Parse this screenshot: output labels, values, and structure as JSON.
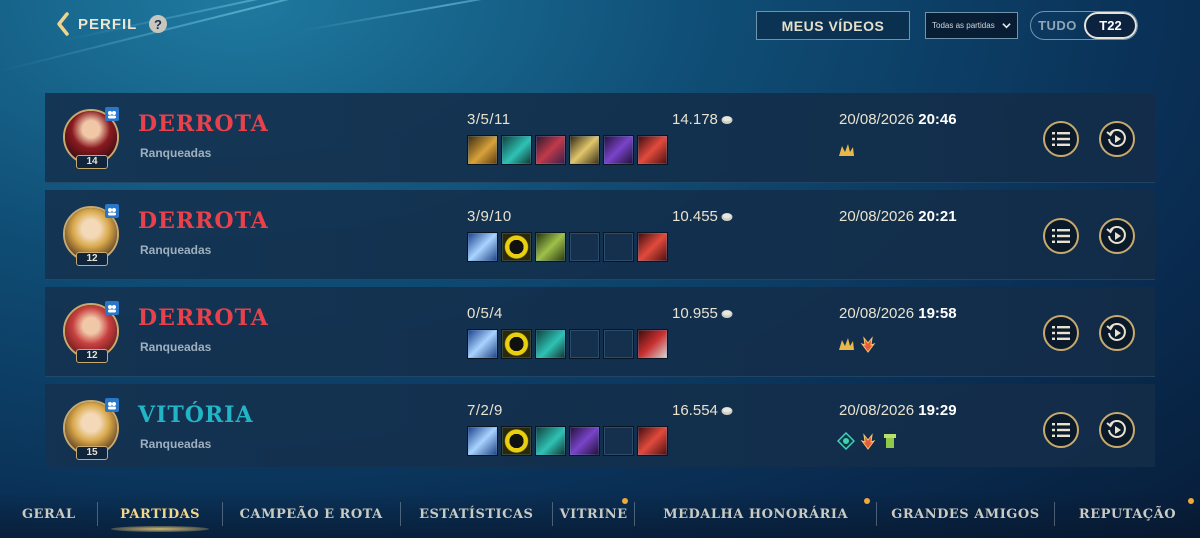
{
  "header": {
    "back_label": "PERFIL",
    "help_label": "?",
    "videos_button": "MEUS VÍDEOS",
    "filter_value": "Todas as partidas",
    "season_toggle": [
      "TUDO",
      "T22"
    ]
  },
  "colors": {
    "defeat": "#e8414b",
    "victory": "#21b5c6",
    "gold_border": "#c8aa6e"
  },
  "matches": [
    {
      "result": "DERROTA",
      "outcome": "defeat",
      "queue": "Ranqueadas",
      "level": "14",
      "kda": "3/5/11",
      "gold": "14.178",
      "date": "20/08/2026",
      "time": "20:46",
      "items": [
        "item-gold",
        "item-teal",
        "item-red",
        "item-blade",
        "item-purple",
        "item-red-claw"
      ],
      "badges": [
        "triple-kill-badge"
      ]
    },
    {
      "result": "DERROTA",
      "outcome": "defeat",
      "queue": "Ranqueadas",
      "level": "12",
      "kda": "3/9/10",
      "gold": "10.455",
      "date": "20/08/2026",
      "time": "20:21",
      "items": [
        "item-blue",
        "item-yellow",
        "item-green",
        "empty",
        "empty",
        "item-red-claw"
      ],
      "badges": []
    },
    {
      "result": "DERROTA",
      "outcome": "defeat",
      "queue": "Ranqueadas",
      "level": "12",
      "kda": "0/5/4",
      "gold": "10.955",
      "date": "20/08/2026",
      "time": "19:58",
      "items": [
        "item-blue",
        "item-yellow",
        "item-teal",
        "empty",
        "empty",
        "item-red-boot"
      ],
      "badges": [
        "triple-kill-badge",
        "fire-badge"
      ]
    },
    {
      "result": "VITÓRIA",
      "outcome": "victory",
      "queue": "Ranqueadas",
      "level": "15",
      "kda": "7/2/9",
      "gold": "16.554",
      "date": "20/08/2026",
      "time": "19:29",
      "items": [
        "item-blue",
        "item-yellow",
        "item-teal",
        "item-purple",
        "empty",
        "item-red-claw"
      ],
      "badges": [
        "shield-badge",
        "fire-badge",
        "tower-badge"
      ]
    }
  ],
  "tabs": [
    {
      "label": "GERAL",
      "active": false,
      "dot": false
    },
    {
      "label": "PARTIDAS",
      "active": true,
      "dot": false
    },
    {
      "label": "CAMPEÃO E ROTA",
      "active": false,
      "dot": false
    },
    {
      "label": "ESTATÍSTICAS",
      "active": false,
      "dot": false
    },
    {
      "label": "VITRINE",
      "active": false,
      "dot": true
    },
    {
      "label": "MEDALHA HONORÁRIA",
      "active": false,
      "dot": true
    },
    {
      "label": "GRANDES AMIGOS",
      "active": false,
      "dot": false
    },
    {
      "label": "REPUTAÇÃO",
      "active": false,
      "dot": true
    }
  ]
}
